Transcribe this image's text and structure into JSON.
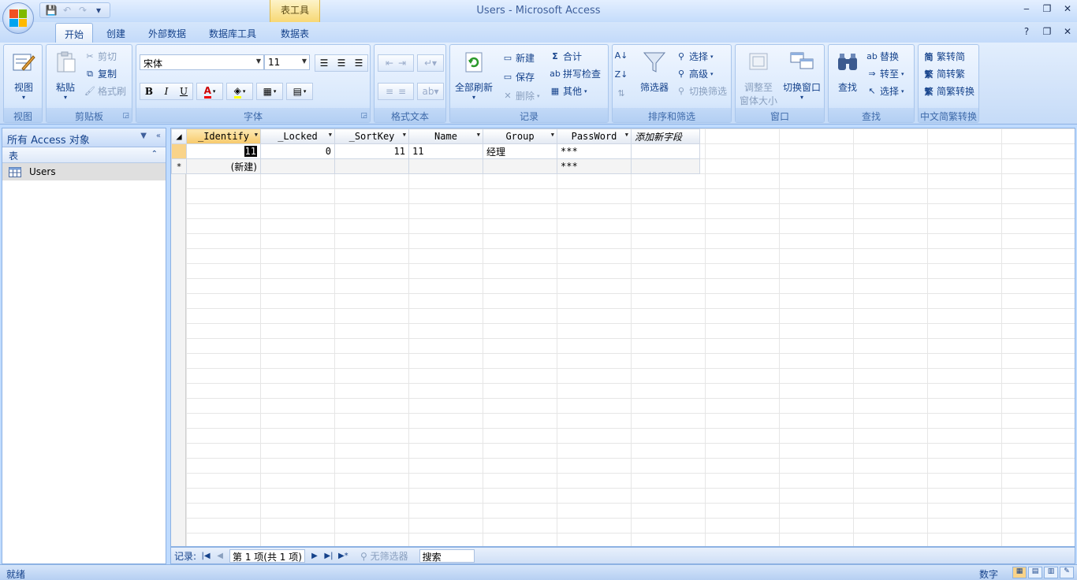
{
  "window": {
    "title": "Users - Microsoft Access",
    "contextual_tab": "表工具",
    "minimize": "‒",
    "restore": "❐",
    "close": "✕"
  },
  "qat": {
    "save": "💾",
    "undo": "↶",
    "redo": "↷",
    "customize": "▾"
  },
  "tabs": [
    {
      "label": "开始",
      "active": true
    },
    {
      "label": "创建"
    },
    {
      "label": "外部数据"
    },
    {
      "label": "数据库工具"
    },
    {
      "label": "数据表"
    }
  ],
  "help": {
    "help": "?",
    "restore": "❐",
    "close": "✕"
  },
  "ribbon": {
    "view": {
      "label": "视图",
      "group": "视图"
    },
    "clipboard": {
      "paste": "粘贴",
      "cut": "剪切",
      "copy": "复制",
      "format_painter": "格式刷",
      "group": "剪贴板"
    },
    "font": {
      "name": "宋体",
      "size": "11",
      "bold": "B",
      "italic": "I",
      "underline": "U",
      "group": "字体"
    },
    "rich_text": {
      "group": "格式文本"
    },
    "records": {
      "refresh_all": "全部刷新",
      "new": "新建",
      "save": "保存",
      "delete": "删除",
      "totals": "合计",
      "spelling": "拼写检查",
      "more": "其他",
      "group": "记录"
    },
    "sort_filter": {
      "filter": "筛选器",
      "selection": "选择",
      "advanced": "高级",
      "toggle_filter": "切换筛选",
      "group": "排序和筛选"
    },
    "window": {
      "size_to_fit": "调整至",
      "size_to_fit2": "窗体大小",
      "switch_windows": "切换窗口",
      "group": "窗口"
    },
    "find": {
      "find": "查找",
      "replace": "替换",
      "goto": "转至",
      "select": "选择",
      "group": "查找"
    },
    "chinese": {
      "t2s": "繁转简",
      "s2t": "简转繁",
      "convert": "简繁转换",
      "group": "中文简繁转换"
    }
  },
  "nav": {
    "title": "所有 Access 对象",
    "group": "表",
    "items": [
      {
        "label": "Users"
      }
    ]
  },
  "datasheet": {
    "columns": [
      "_Identify",
      "_Locked",
      "_SortKey",
      "Name",
      "Group",
      "PassWord"
    ],
    "add_field": "添加新字段",
    "rows": [
      {
        "_Identify": "11",
        "_Locked": "0",
        "_SortKey": "11",
        "Name": "11",
        "Group": "经理",
        "PassWord": "***"
      }
    ],
    "new_row": {
      "marker": "*",
      "label": "(新建)",
      "PassWord": "***"
    }
  },
  "record_nav": {
    "label": "记录:",
    "position": "第 1 项(共 1 项)",
    "filter": "无筛选器",
    "search": "搜索"
  },
  "status": {
    "left": "就绪",
    "right": "数字"
  }
}
